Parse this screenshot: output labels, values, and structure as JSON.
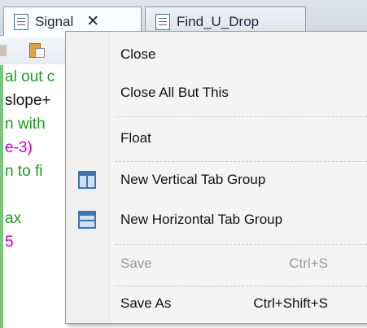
{
  "tabs": [
    {
      "label": "Signal",
      "close_glyph": "✕",
      "active": true,
      "icon": "document-icon"
    },
    {
      "label": "Find_U_Drop",
      "active": false,
      "icon": "document-icon"
    }
  ],
  "code_lines": [
    {
      "text": "al out c",
      "color": "green"
    },
    {
      "text": "slope+",
      "color": "black"
    },
    {
      "text": "n with",
      "color": "green"
    },
    {
      "text": "e-3)",
      "color": "magenta"
    },
    {
      "text": "n to fi",
      "color": "green"
    },
    {
      "text": "",
      "color": "black"
    },
    {
      "text": "ax",
      "color": "green"
    },
    {
      "text": "5",
      "color": "magenta"
    }
  ],
  "context_menu": {
    "items": [
      {
        "label": "Close",
        "shortcut": "",
        "enabled": true,
        "icon": ""
      },
      {
        "label": "Close All But This",
        "shortcut": "",
        "enabled": true,
        "icon": ""
      },
      {
        "label": "Float",
        "shortcut": "",
        "enabled": true,
        "icon": ""
      },
      {
        "label": "New Vertical Tab Group",
        "shortcut": "",
        "enabled": true,
        "icon": "vertical-tab-group-icon"
      },
      {
        "label": "New Horizontal Tab Group",
        "shortcut": "",
        "enabled": true,
        "icon": "horizontal-tab-group-icon"
      },
      {
        "label": "Save",
        "shortcut": "Ctrl+S",
        "enabled": false,
        "icon": ""
      },
      {
        "label": "Save As",
        "shortcut": "Ctrl+Shift+S",
        "enabled": true,
        "icon": ""
      }
    ]
  },
  "colors": {
    "code_green": "#1f9a22",
    "code_magenta": "#d000d0",
    "menu_background": "#f4f4f4",
    "icon_blue": "#3f74b0",
    "disabled_text": "#9a9a9a"
  }
}
